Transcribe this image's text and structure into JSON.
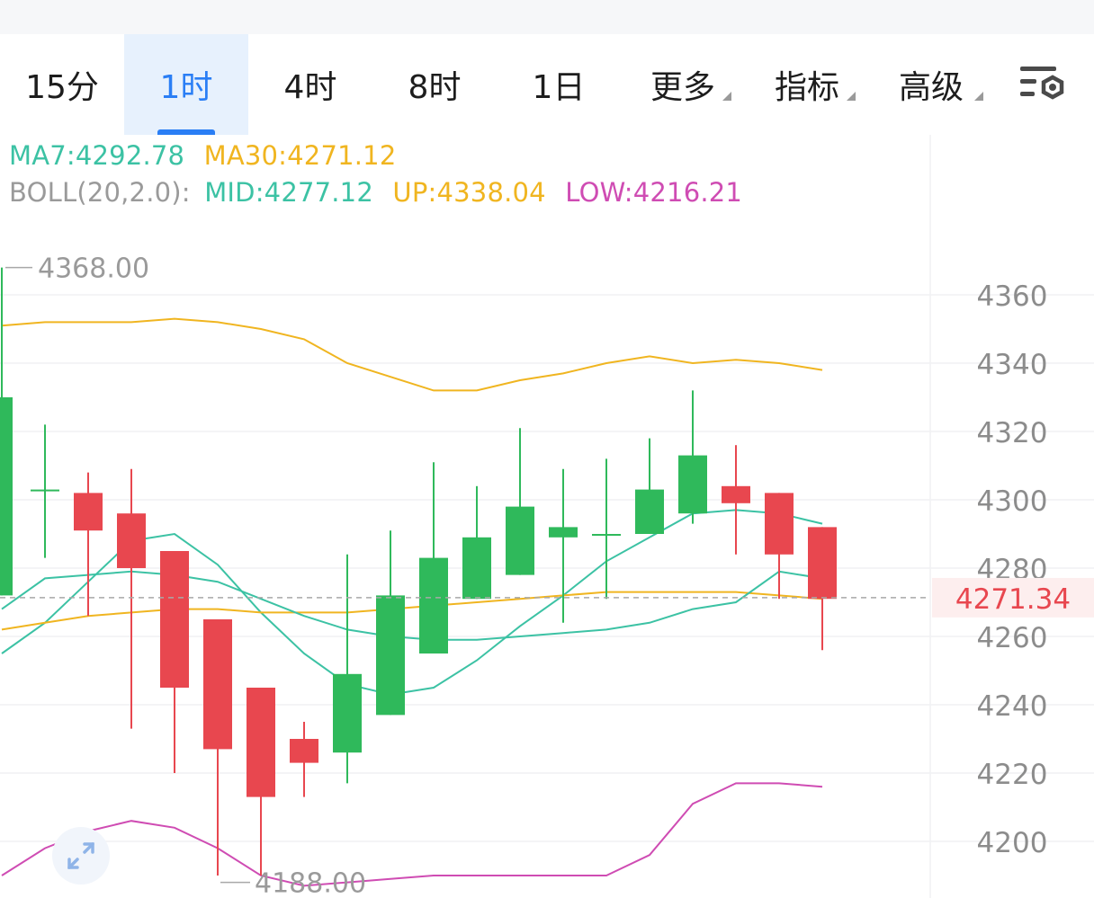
{
  "tabs": [
    {
      "label": "15分",
      "active": false
    },
    {
      "label": "1时",
      "active": true
    },
    {
      "label": "4时",
      "active": false
    },
    {
      "label": "8时",
      "active": false
    },
    {
      "label": "1日",
      "active": false
    },
    {
      "label": "更多",
      "active": false,
      "dropdown": true
    },
    {
      "label": "指标",
      "active": false,
      "dropdown": true
    },
    {
      "label": "高级",
      "active": false,
      "dropdown": true
    }
  ],
  "settings_icon": "indicator-settings-icon",
  "legend": {
    "ma7": "MA7:4292.78",
    "ma30": "MA30:4271.12",
    "boll_label": "BOLL(20,2.0):",
    "mid": "MID:4277.12",
    "up": "UP:4338.04",
    "low": "LOW:4216.21"
  },
  "colors": {
    "up": "#2fb95b",
    "down": "#e8474f",
    "ma7": "#3cc2a4",
    "ma30": "#f0b520",
    "boll_mid": "#3cc2a4",
    "boll_up": "#f0b520",
    "boll_low": "#cf4cb3",
    "current_price": "#e8474f"
  },
  "chart_data": {
    "type": "candlestick",
    "y_ticks": [
      4360,
      4340,
      4320,
      4300,
      4280,
      4260,
      4240,
      4220,
      4200
    ],
    "ylim": [
      4192,
      4370
    ],
    "current_price": "4271.34",
    "high_marker": {
      "label": "4368.00",
      "value": 4368
    },
    "low_marker": {
      "label": "4188.00",
      "value": 4188
    },
    "candles": [
      {
        "o": 4272,
        "h": 4368,
        "c": 4330,
        "l": 4272
      },
      {
        "o": 4303,
        "h": 4322,
        "c": 4303,
        "l": 4283
      },
      {
        "o": 4302,
        "h": 4308,
        "c": 4291,
        "l": 4266
      },
      {
        "o": 4296,
        "h": 4309,
        "c": 4280,
        "l": 4233
      },
      {
        "o": 4285,
        "h": 4285,
        "c": 4245,
        "l": 4220
      },
      {
        "o": 4265,
        "h": 4265,
        "c": 4227,
        "l": 4190
      },
      {
        "o": 4245,
        "h": 4245,
        "c": 4213,
        "l": 4190
      },
      {
        "o": 4230,
        "h": 4235,
        "c": 4223,
        "l": 4213
      },
      {
        "o": 4226,
        "h": 4284,
        "c": 4249,
        "l": 4217
      },
      {
        "o": 4237,
        "h": 4291,
        "c": 4272,
        "l": 4237
      },
      {
        "o": 4255,
        "h": 4311,
        "c": 4283,
        "l": 4255
      },
      {
        "o": 4271,
        "h": 4304,
        "c": 4289,
        "l": 4271
      },
      {
        "o": 4278,
        "h": 4321,
        "c": 4298,
        "l": 4278
      },
      {
        "o": 4289,
        "h": 4309,
        "c": 4292,
        "l": 4264
      },
      {
        "o": 4290,
        "h": 4312,
        "c": 4290,
        "l": 4271
      },
      {
        "o": 4290,
        "h": 4318,
        "c": 4303,
        "l": 4290
      },
      {
        "o": 4296,
        "h": 4332,
        "c": 4313,
        "l": 4293
      },
      {
        "o": 4304,
        "h": 4316,
        "c": 4299,
        "l": 4284
      },
      {
        "o": 4302,
        "h": 4302,
        "c": 4284,
        "l": 4271
      },
      {
        "o": 4292,
        "h": 4292,
        "c": 4271,
        "l": 4256
      }
    ],
    "series": [
      {
        "key": "ma7",
        "values": [
          4255,
          4264,
          4276,
          4288,
          4290,
          4281,
          4267,
          4255,
          4246,
          4243,
          4245,
          4253,
          4263,
          4272,
          4282,
          4289,
          4296,
          4297,
          4296,
          4293
        ]
      },
      {
        "key": "ma30",
        "values": [
          4262,
          4264,
          4266,
          4267,
          4268,
          4268,
          4267,
          4267,
          4267,
          4268,
          4269,
          4270,
          4271,
          4272,
          4273,
          4273,
          4273,
          4273,
          4272,
          4271
        ]
      },
      {
        "key": "boll_mid",
        "values": [
          4268,
          4277,
          4278,
          4279,
          4278,
          4276,
          4271,
          4266,
          4262,
          4260,
          4259,
          4259,
          4260,
          4261,
          4262,
          4264,
          4268,
          4270,
          4279,
          4277
        ]
      },
      {
        "key": "boll_up",
        "values": [
          4351,
          4352,
          4352,
          4352,
          4353,
          4352,
          4350,
          4347,
          4340,
          4336,
          4332,
          4332,
          4335,
          4337,
          4340,
          4342,
          4340,
          4341,
          4340,
          4338
        ]
      },
      {
        "key": "boll_low",
        "values": [
          4190,
          4198,
          4203,
          4206,
          4204,
          4198,
          4190,
          4187,
          4188,
          4189,
          4190,
          4190,
          4190,
          4190,
          4190,
          4196,
          4211,
          4217,
          4217,
          4216
        ]
      }
    ]
  }
}
